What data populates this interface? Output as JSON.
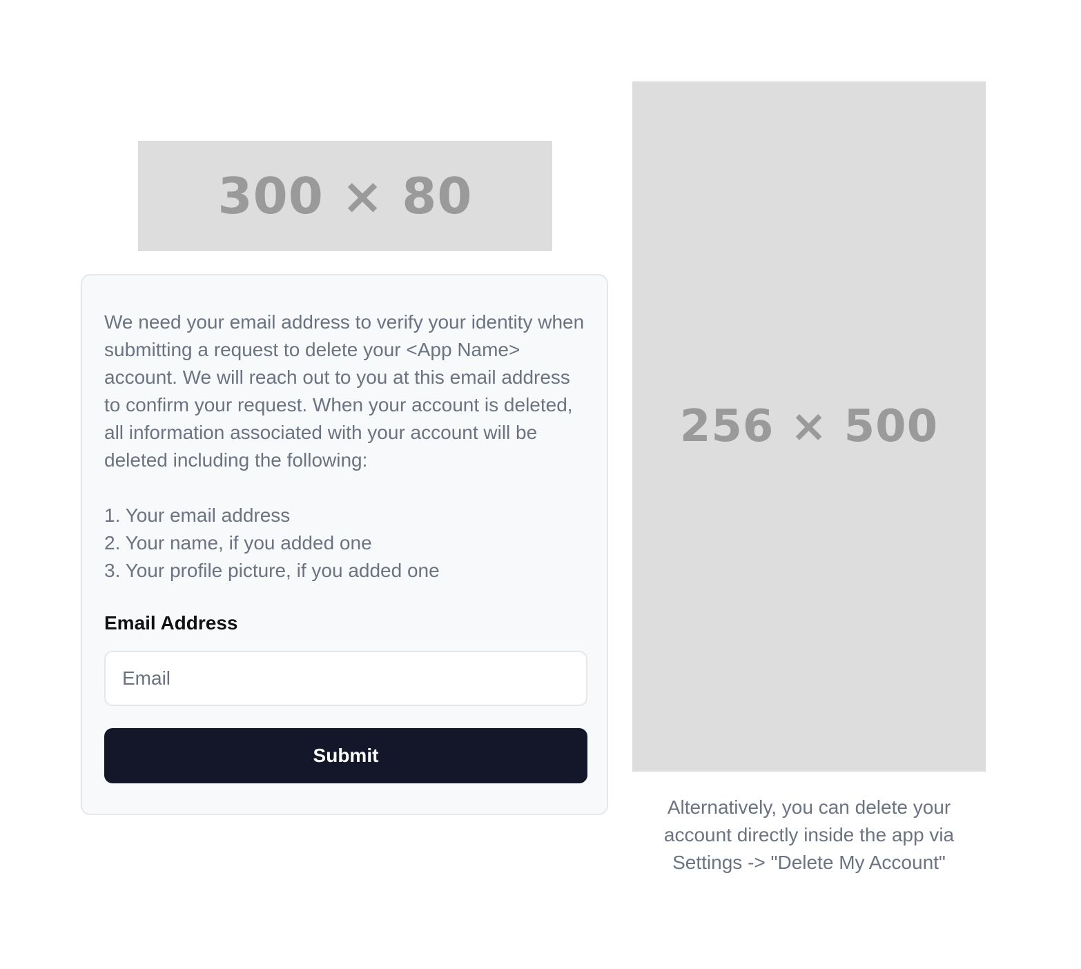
{
  "logo": {
    "placeholder_text": "300 × 80"
  },
  "form": {
    "intro_text": "We need your email address to verify your identity when submitting a request to delete your <App Name> account. We will reach out to you at this email address to confirm your request. When your account is deleted, all information associated with your account will be deleted including the following:",
    "deleted_items": [
      "1. Your email address",
      "2. Your name, if you added one",
      "3. Your profile picture, if you added one"
    ],
    "email_label": "Email Address",
    "email_placeholder": "Email",
    "email_value": "",
    "submit_label": "Submit"
  },
  "screenshot": {
    "placeholder_text": "256 × 500"
  },
  "alternative_note": "Alternatively, you can delete your account directly inside the app via Settings -> \"Delete My Account\"",
  "colors": {
    "button_background": "#131729",
    "card_background": "#f8f9fb",
    "placeholder_gray": "#dddddd",
    "muted_text": "#6b7280"
  }
}
